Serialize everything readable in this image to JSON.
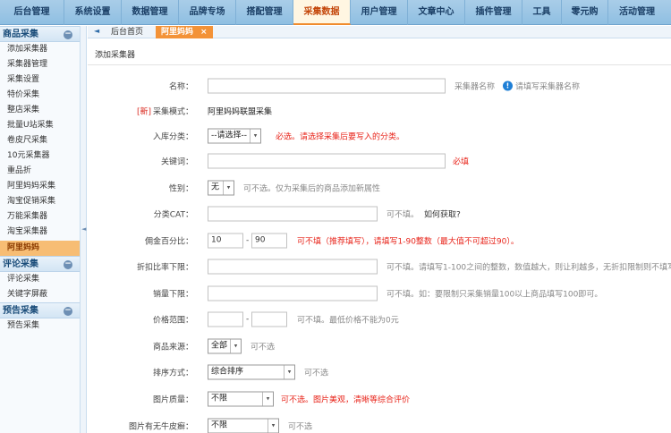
{
  "top_nav": [
    "后台管理",
    "系统设置",
    "数据管理",
    "品牌专场",
    "搭配管理",
    "采集数据",
    "用户管理",
    "文章中心",
    "插件管理",
    "工具",
    "零元购",
    "活动管理"
  ],
  "top_nav_active": "采集数据",
  "sidebar": {
    "sec1": {
      "title": "商品采集",
      "toggle": "−"
    },
    "sec1_items": [
      "添加采集器",
      "采集器管理",
      "采集设置",
      "特价采集",
      "整店采集",
      "批量U站采集",
      "卷皮尺采集",
      "10元采集器",
      "重品折",
      "阿里妈妈采集",
      "淘宝促销采集",
      "万能采集器",
      "淘宝采集器",
      "阿里妈妈"
    ],
    "sec2": {
      "title": "评论采集",
      "toggle": "−"
    },
    "sec2_items": [
      "评论采集",
      "关键字屏蔽"
    ],
    "sec3": {
      "title": "预告采集",
      "toggle": "−"
    },
    "sec3_items": [
      "预告采集"
    ]
  },
  "tabs": {
    "left_arrow": "◄",
    "home": "后台首页",
    "current": "阿里妈妈",
    "close": "×"
  },
  "splitter_arrow": "◄",
  "page_title": "添加采集器",
  "form": {
    "name": {
      "label": "名称：",
      "value": "",
      "hint": "采集器名称",
      "info_icon": "!",
      "info_text": "请填写采集器名称"
    },
    "mode": {
      "new_tag": "[新]",
      "label": "采集模式：",
      "value": "阿里妈妈联盟采集"
    },
    "category": {
      "label": "入库分类：",
      "value": "--请选择--",
      "caret": "▾",
      "hint": "必选。请选择采集后要写入的分类。"
    },
    "keyword": {
      "label": "关键词：",
      "value": "",
      "hint": "必填"
    },
    "gender": {
      "label": "性别：",
      "value": "无",
      "caret": "▾",
      "hint": "可不选。仅为采集后的商品添加新属性"
    },
    "cat": {
      "label": "分类CAT：",
      "value": "",
      "hint": "可不填。",
      "link": "如何获取?"
    },
    "commission": {
      "label": "佣金百分比：",
      "min": "10",
      "dash": "-",
      "max": "90",
      "hint": "可不填（推荐填写），请填写1-90整数（最大值不可超过90）。"
    },
    "discount": {
      "label": "折扣比率下限：",
      "value": "",
      "hint": "可不填。请填写1-100之间的整数，数值越大，则让利越多，无折扣限制则不填写。"
    },
    "sales": {
      "label": "销量下限：",
      "value": "",
      "hint": "可不填。如：要限制只采集销量100以上商品填写100即可。"
    },
    "price": {
      "label": "价格范围：",
      "min": "",
      "dash": "-",
      "max": "",
      "hint": "可不填。最低价格不能为0元"
    },
    "source": {
      "label": "商品来源：",
      "value": "全部",
      "caret": "▾",
      "hint": "可不选"
    },
    "sort": {
      "label": "排序方式：",
      "value": "综合排序",
      "caret": "▾",
      "hint": "可不选"
    },
    "image_quality": {
      "label": "图片质量：",
      "value": "不限",
      "caret": "▾",
      "hint": "可不选。图片美观，清晰等综合评价"
    },
    "image_leather": {
      "label": "图片有无牛皮癣：",
      "value": "不限",
      "caret": "▾",
      "hint": "可不选"
    }
  }
}
